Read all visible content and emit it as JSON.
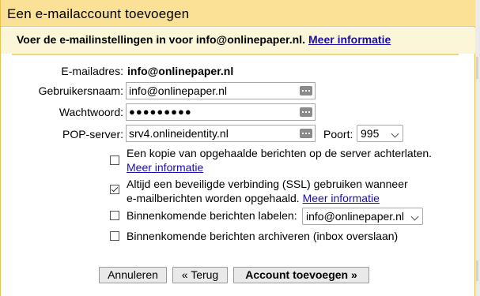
{
  "dialog": {
    "title": "Een e-mailaccount toevoegen",
    "intro": "Voer de e-mailinstellingen in voor info@onlinepaper.nl.",
    "intro_link": "Meer informatie"
  },
  "form": {
    "email_label": "E-mailadres:",
    "email_value": "info@onlinepaper.nl",
    "username_label": "Gebruikersnaam:",
    "username_value": "info@onlinepaper.nl",
    "password_label": "Wachtwoord:",
    "password_value": "●●●●●●●●●",
    "pop_label": "POP-server:",
    "pop_value": "srv4.onlineidentity.nl",
    "port_label": "Poort:",
    "port_value": "995"
  },
  "options": {
    "leave_copy": "Een kopie van opgehaalde berichten op de server achterlaten.",
    "leave_copy_link": "Meer informatie",
    "leave_copy_checked": false,
    "ssl_line1": "Altijd een beveiligde verbinding (SSL) gebruiken wanneer",
    "ssl_line2": "e-mailberichten worden opgehaald.",
    "ssl_link": "Meer informatie",
    "ssl_checked": true,
    "label_incoming": "Binnenkomende berichten labelen:",
    "label_value": "info@onlinepaper.nl",
    "label_checked": false,
    "archive_incoming": "Binnenkomende berichten archiveren (inbox overslaan)",
    "archive_checked": false
  },
  "buttons": {
    "cancel": "Annuleren",
    "back": "« Terug",
    "add": "Account toevoegen »"
  },
  "icons": {
    "field_key": "password-manager-icon",
    "dropdown": "chevron-down-icon"
  },
  "colors": {
    "title_bar": "#fbe196",
    "intro_bg": "#fcf6d9",
    "link": "#1a0dab"
  }
}
